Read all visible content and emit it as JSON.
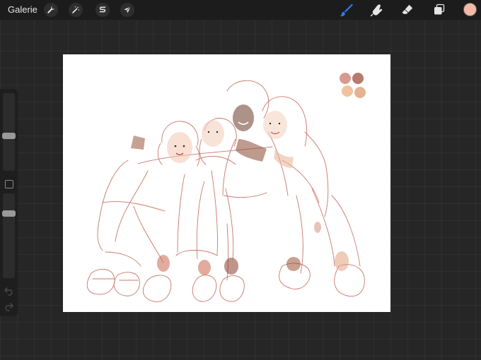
{
  "topbar": {
    "gallery_label": "Galerie",
    "left_tools": [
      {
        "name": "actions",
        "icon": "wrench-icon"
      },
      {
        "name": "adjustments",
        "icon": "magic-wand-icon"
      },
      {
        "name": "selection",
        "icon": "selection-s-icon"
      },
      {
        "name": "transform",
        "icon": "arrow-cursor-icon"
      }
    ],
    "right_tools": [
      {
        "name": "brush",
        "icon": "brush-icon",
        "active": true
      },
      {
        "name": "smudge",
        "icon": "smudge-finger-icon"
      },
      {
        "name": "eraser",
        "icon": "eraser-icon"
      },
      {
        "name": "layers",
        "icon": "layers-icon"
      }
    ],
    "current_color": "#f4b9a6",
    "active_tool_color": "#2f7bf6"
  },
  "sidebar": {
    "brush_size": 0.45,
    "opacity": 0.78,
    "buttons": [
      "undo-icon",
      "redo-icon",
      "modify-square-icon"
    ]
  },
  "canvas": {
    "background": "#ffffff",
    "palette": [
      "#d79c8f",
      "#b57b6d",
      "#efc3a0",
      "#e6b292"
    ]
  }
}
